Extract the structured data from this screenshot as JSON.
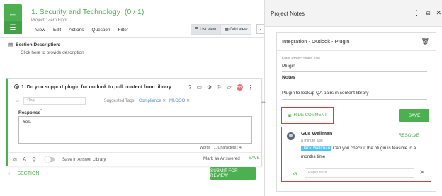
{
  "header": {
    "title": "1. Security and Technology",
    "count": "(0 / 1)",
    "project": "Project : Zero Floor",
    "menu": [
      "View",
      "Edit",
      "Actions",
      "Question",
      "Filter"
    ],
    "views": {
      "list": "List view",
      "grid": "Grid view"
    }
  },
  "section": {
    "label": "Section Description:",
    "placeholder": "Click here to provide description"
  },
  "question": {
    "title": "1. Do you support plugin for outlook to pull content from library",
    "avatar": "BB",
    "tag_placeholder": "+Tag",
    "suggested_label": "Suggested Tags:",
    "suggested_tags": [
      "Compliance",
      "MLOOO"
    ],
    "response_label": "Response",
    "response_value": "Yes.",
    "word_count": "Words : 1, Characters : 4",
    "save_in_library": "Save in Answer Library",
    "mark_answered": "Mark as Answered",
    "save": "SAVE"
  },
  "nav": {
    "section": "SECTION",
    "submit": "SUBMIT FOR REVIEW"
  },
  "panel": {
    "title": "Project Notes",
    "note": {
      "heading": "Integration - Outlook - Plugin",
      "title_label": "Enter Project Notes Title",
      "title_value": "Plugin",
      "notes_label": "Notes",
      "notes_value": "Plugin to lookup QA pairs in content library",
      "hide_comment": "HIDE COMMENT",
      "save": "SAVE"
    },
    "comment": {
      "author": "Gus Wellman",
      "time": "a minute ago",
      "resolve": "RESOLVE",
      "mention": "Jack Wellman",
      "text": "Can you check if the plugin is feasible in a months time",
      "reply_placeholder": "Reply here..."
    }
  }
}
